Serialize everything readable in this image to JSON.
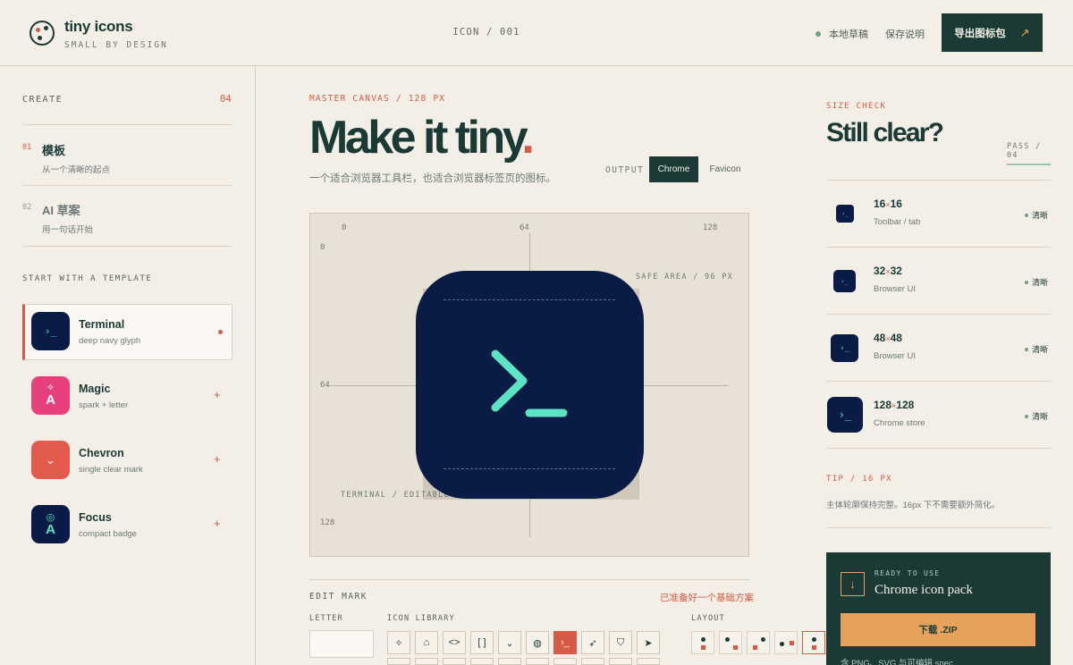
{
  "header": {
    "brand": "tiny icons",
    "tagline": "SMALL BY DESIGN",
    "center": "ICON / 001",
    "draft_status": "本地草稿",
    "save_note": "保存说明",
    "export_label": "导出图标包",
    "export_arrow": "↗"
  },
  "sidebar": {
    "create_label": "CREATE",
    "create_count": "04",
    "modes": [
      {
        "num": "01",
        "title": "模板",
        "sub": "从一个清晰的起点"
      },
      {
        "num": "02",
        "title": "AI 草案",
        "sub": "用一句话开始"
      }
    ],
    "templates_label": "START WITH A TEMPLATE",
    "templates": [
      {
        "name": "Terminal",
        "desc": "deep navy glyph",
        "color": "#0a1b46",
        "glyph": "›_"
      },
      {
        "name": "Magic",
        "desc": "spark + letter",
        "color": "#e8407c",
        "glyph": "✧",
        "letter": "A"
      },
      {
        "name": "Chevron",
        "desc": "single clear mark",
        "color": "#e25b4e",
        "glyph": "⌄"
      },
      {
        "name": "Focus",
        "desc": "compact badge",
        "color": "#0a1b46",
        "glyph": "◎",
        "letter": "A"
      }
    ],
    "plus": "+"
  },
  "main": {
    "canvas_label": "MASTER CANVAS / 128 PX",
    "headline": "Make it tiny",
    "headline_period": ".",
    "subline": "一个适合浏览器工具栏，也适合浏览器标签页的图标。",
    "output_label": "OUTPUT",
    "output_options": [
      "Chrome",
      "Favicon"
    ],
    "board": {
      "ticks_top": [
        "0",
        "64",
        "128"
      ],
      "ticks_left": [
        "0",
        "64",
        "128"
      ],
      "safe_area": "SAFE AREA / 96 PX",
      "editable": "TERMINAL / EDITABLE",
      "icon_bg": "#0a1b46",
      "glyph_color": "#5ce3c4"
    },
    "edit_mark": "EDIT MARK",
    "edit_note": "已准备好一个基础方案",
    "letter_label": "LETTER",
    "letter_value": "",
    "library_label": "ICON LIBRARY",
    "library_icons": [
      "sparkles-icon",
      "robot-icon",
      "code-icon",
      "brackets-icon",
      "chevron-down-icon",
      "palette-icon",
      "terminal-icon",
      "rocket-icon",
      "shield-check-icon",
      "cursor-icon"
    ],
    "layout_label": "LAYOUT"
  },
  "right": {
    "size_label": "SIZE CHECK",
    "title": "Still clear?",
    "pass": "PASS / 04",
    "sizes": [
      {
        "a": "16",
        "b": "16",
        "use": "Toolbar / tab",
        "status": "清晰"
      },
      {
        "a": "32",
        "b": "32",
        "use": "Browser UI",
        "status": "清晰"
      },
      {
        "a": "48",
        "b": "48",
        "use": "Browser UI",
        "status": "清晰"
      },
      {
        "a": "128",
        "b": "128",
        "use": "Chrome store",
        "status": "清晰"
      }
    ],
    "times": "×",
    "tip_label": "TIP / 16 PX",
    "tip_text": "主体轮廓保持完整。16px 下不需要额外简化。",
    "pack": {
      "ready": "READY TO USE",
      "title": "Chrome icon pack",
      "download": "下载 .ZIP",
      "footer": "含 PNG、SVG 与可编辑 spec",
      "icon": "↓"
    }
  }
}
